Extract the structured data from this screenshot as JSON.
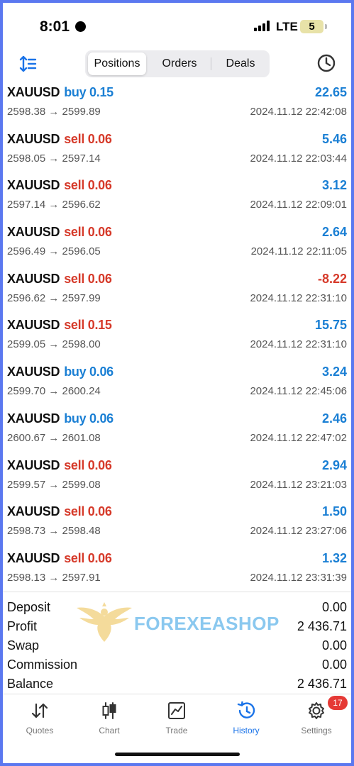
{
  "status_bar": {
    "time": "8:01",
    "network": "LTE",
    "battery": "5"
  },
  "tabs_segment": {
    "items": [
      "Positions",
      "Orders",
      "Deals"
    ],
    "active": 0
  },
  "deals": [
    {
      "symbol": "XAUUSD",
      "side": "buy",
      "volume": "0.15",
      "prices": "2598.38 → 2599.89",
      "profit": "22.65",
      "time": "2024.11.12 22:42:08"
    },
    {
      "symbol": "XAUUSD",
      "side": "sell",
      "volume": "0.06",
      "prices": "2598.05 → 2597.14",
      "profit": "5.46",
      "time": "2024.11.12 22:03:44"
    },
    {
      "symbol": "XAUUSD",
      "side": "sell",
      "volume": "0.06",
      "prices": "2597.14 → 2596.62",
      "profit": "3.12",
      "time": "2024.11.12 22:09:01"
    },
    {
      "symbol": "XAUUSD",
      "side": "sell",
      "volume": "0.06",
      "prices": "2596.49 → 2596.05",
      "profit": "2.64",
      "time": "2024.11.12 22:11:05"
    },
    {
      "symbol": "XAUUSD",
      "side": "sell",
      "volume": "0.06",
      "prices": "2596.62 → 2597.99",
      "profit": "-8.22",
      "time": "2024.11.12 22:31:10"
    },
    {
      "symbol": "XAUUSD",
      "side": "sell",
      "volume": "0.15",
      "prices": "2599.05 → 2598.00",
      "profit": "15.75",
      "time": "2024.11.12 22:31:10"
    },
    {
      "symbol": "XAUUSD",
      "side": "buy",
      "volume": "0.06",
      "prices": "2599.70 → 2600.24",
      "profit": "3.24",
      "time": "2024.11.12 22:45:06"
    },
    {
      "symbol": "XAUUSD",
      "side": "buy",
      "volume": "0.06",
      "prices": "2600.67 → 2601.08",
      "profit": "2.46",
      "time": "2024.11.12 22:47:02"
    },
    {
      "symbol": "XAUUSD",
      "side": "sell",
      "volume": "0.06",
      "prices": "2599.57 → 2599.08",
      "profit": "2.94",
      "time": "2024.11.12 23:21:03"
    },
    {
      "symbol": "XAUUSD",
      "side": "sell",
      "volume": "0.06",
      "prices": "2598.73 → 2598.48",
      "profit": "1.50",
      "time": "2024.11.12 23:27:06"
    },
    {
      "symbol": "XAUUSD",
      "side": "sell",
      "volume": "0.06",
      "prices": "2598.13 → 2597.91",
      "profit": "1.32",
      "time": "2024.11.12 23:31:39"
    }
  ],
  "summary": [
    {
      "label": "Deposit",
      "value": "0.00"
    },
    {
      "label": "Profit",
      "value": "2 436.71"
    },
    {
      "label": "Swap",
      "value": "0.00"
    },
    {
      "label": "Commission",
      "value": "0.00"
    },
    {
      "label": "Balance",
      "value": "2 436.71"
    }
  ],
  "watermark": {
    "text": "FOREXEASHOP"
  },
  "tabbar": {
    "items": [
      {
        "label": "Quotes",
        "icon": "quotes-icon"
      },
      {
        "label": "Chart",
        "icon": "chart-icon"
      },
      {
        "label": "Trade",
        "icon": "trade-icon"
      },
      {
        "label": "History",
        "icon": "history-icon"
      },
      {
        "label": "Settings",
        "icon": "settings-icon",
        "badge": "17"
      }
    ],
    "active": 3
  },
  "colors": {
    "buy": "#1a7fd4",
    "sell": "#d63a2a",
    "accent": "#1a73e8",
    "frame": "#5b78f0"
  }
}
